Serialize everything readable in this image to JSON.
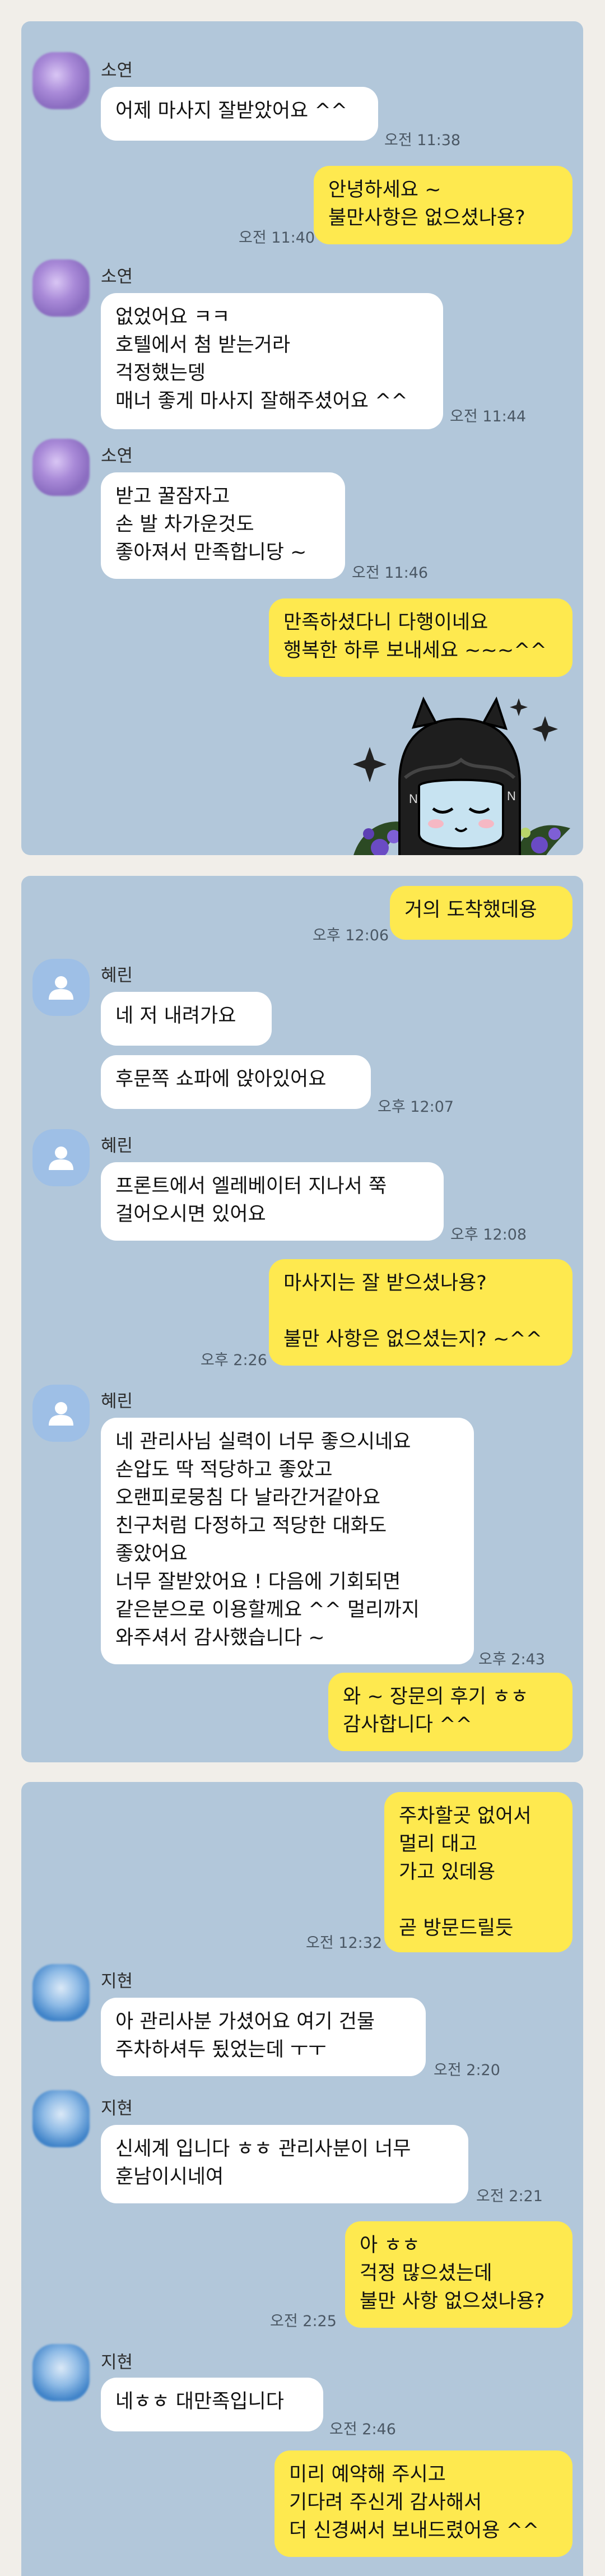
{
  "panel1": {
    "name1": "소연",
    "msg1": "어제 마사지 잘받았어요 ^^",
    "time1": "오전 11:38",
    "out1": "안녕하세요 ~\n불만사항은 없으셨나용?",
    "time2": "오전 11:40",
    "name2": "소연",
    "msg2": "없었어요 ㅋㅋ\n호텔에서 첨 받는거라\n걱정했는뎅\n매너 좋게 마사지 잘해주셨어요 ^^",
    "time3": "오전 11:44",
    "name3": "소연",
    "msg3": "받고 꿀잠자고\n손 발 차가운것도\n좋아져서 만족합니당 ~",
    "time4": "오전 11:46",
    "out2": "만족하셨다니 다행이네요\n행복한 하루 보내세요 ~~~^^",
    "sticker": "sleeping-cat-sticker"
  },
  "panel2": {
    "out1": "거의 도착했데용",
    "time1": "오후 12:06",
    "name1": "혜린",
    "msg1": "네 저 내려가요",
    "msg2": "후문쪽 쇼파에 앉아있어요",
    "time2": "오후 12:07",
    "name2": "혜린",
    "msg3": "프론트에서 엘레베이터 지나서 쭉\n걸어오시면 있어요",
    "time3": "오후 12:08",
    "out2": "마사지는 잘 받으셨나용?\n\n불만 사항은 없으셨는지? ~^^",
    "time4": "오후 2:26",
    "name3": "혜린",
    "msg4": "네 관리사님 실력이 너무 좋으시네요\n손압도 딱 적당하고 좋았고\n오랜피로뭉침 다 날라간거같아요\n친구처럼 다정하고 적당한 대화도\n좋았어요\n너무 잘받았어요 ! 다음에 기회되면\n같은분으로 이용할께요 ^^ 멀리까지\n와주셔서 감사했습니다 ~",
    "time5": "오후 2:43",
    "out3": "와 ~ 장문의 후기 ㅎㅎ\n감사합니다 ^^"
  },
  "panel3": {
    "out1": "주차할곳 없어서\n멀리 대고\n가고 있데용\n\n곧 방문드릴듯",
    "time1": "오전 12:32",
    "name1": "지현",
    "msg1": "아 관리사분 가셨어요 여기 건물\n주차하셔두 됬었는데 ㅜㅜ",
    "time2": "오전 2:20",
    "name2": "지현",
    "msg2": "신세계 입니다 ㅎㅎ 관리사분이 너무\n훈남이시네여",
    "time3": "오전 2:21",
    "out2": "아 ㅎㅎ\n걱정 많으셨는데\n불만 사항 없으셨나용?",
    "time4": "오전 2:25",
    "name3": "지현",
    "msg3": "네ㅎㅎ 대만족입니다",
    "time5": "오전 2:46",
    "out3": "미리 예약해 주시고\n기다려 주신게 감사해서\n더 신경써서 보내드렸어용 ^^"
  },
  "colors": {
    "chat_bg": "#b2c7da",
    "outgoing": "#fee94f",
    "incoming": "#ffffff"
  }
}
